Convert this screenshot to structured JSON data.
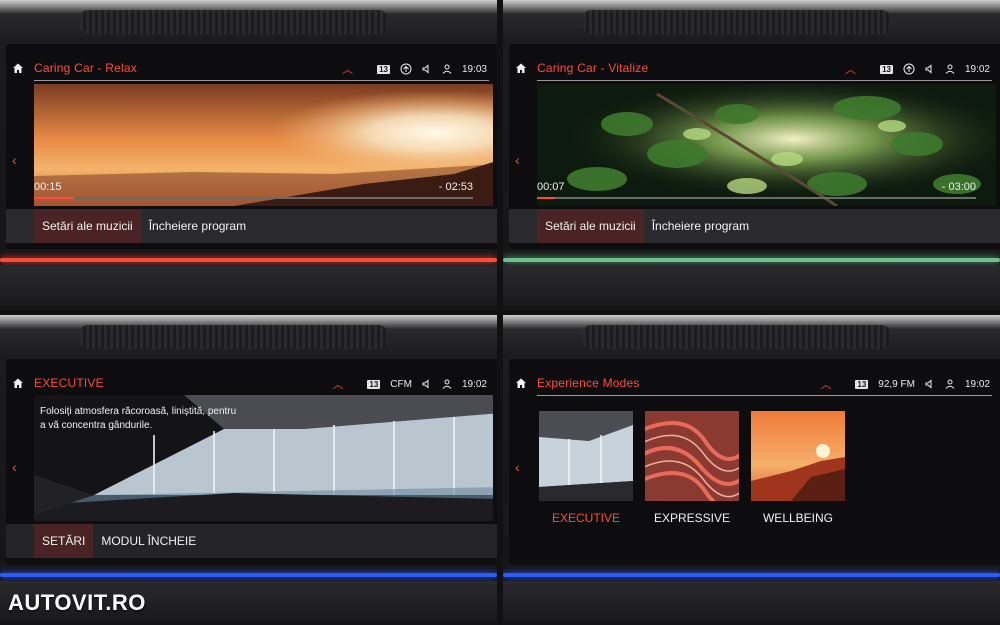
{
  "panels": [
    {
      "title": "Caring Car - Relax",
      "badge": "13",
      "clock": "19:03",
      "elapsed": "00:15",
      "remaining": "- 02:53",
      "progress_pct": 9,
      "buttons": [
        "Setări ale muzicii",
        "Încheiere program"
      ],
      "ambient_color": "#ff4b3b"
    },
    {
      "title": "Caring Car - Vitalize",
      "badge": "13",
      "clock": "19:02",
      "elapsed": "00:07",
      "remaining": "- 03:00",
      "progress_pct": 4,
      "buttons": [
        "Setări ale muzicii",
        "Încheiere program"
      ],
      "ambient_color": "#6fbf8b"
    },
    {
      "title": "EXECUTIVE",
      "badge": "13",
      "station": "CFM",
      "clock": "19:02",
      "description": "Folosiți atmosfera răcoroasă, liniștită, pentru a vă concentra gândurile.",
      "buttons": [
        "SETĂRI",
        "MODUL ÎNCHEIE"
      ],
      "ambient_color": "#2a5cff"
    },
    {
      "title": "Experience Modes",
      "badge": "13",
      "station": "92,9 FM",
      "clock": "19:02",
      "modes": [
        "EXECUTIVE",
        "EXPRESSIVE",
        "WELLBEING"
      ],
      "selected_mode": "EXECUTIVE",
      "ambient_color": "#2a5cff"
    }
  ],
  "watermark": "AUTOVIT.RO",
  "colors": {
    "accent": "#ff4b3b"
  }
}
